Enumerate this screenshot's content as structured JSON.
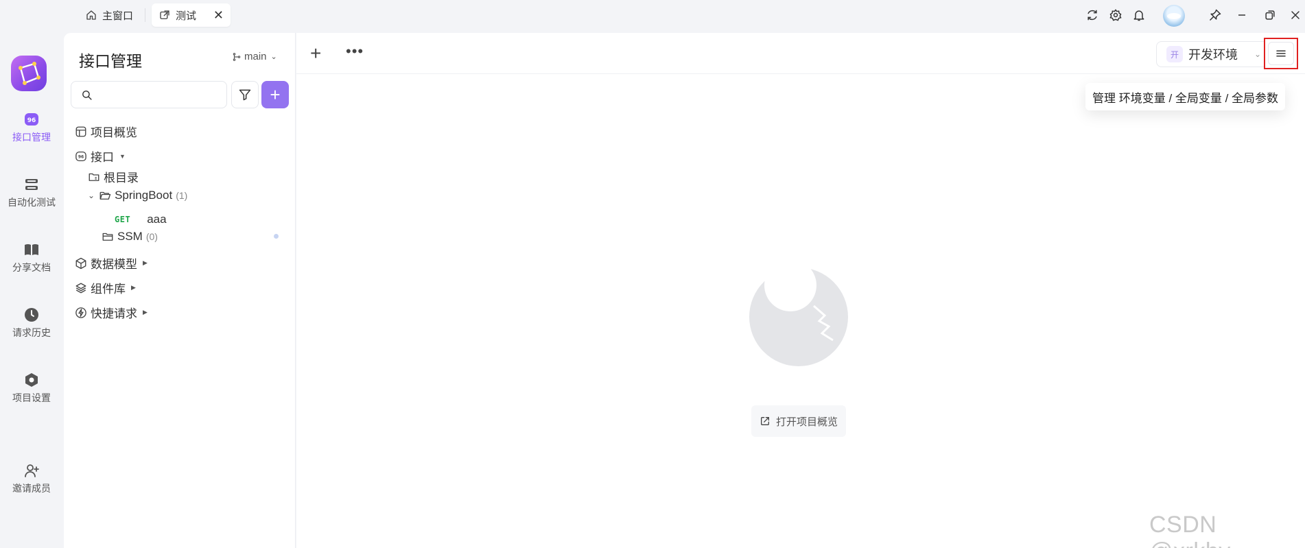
{
  "titlebar": {
    "tabs": [
      {
        "label": "主窗口"
      },
      {
        "label": "测试"
      }
    ],
    "close_glyph": "✕",
    "icons": [
      "refresh-icon",
      "gear-icon",
      "bell-icon",
      "avatar",
      "pin-icon",
      "minimize-icon",
      "restore-icon",
      "close-icon"
    ]
  },
  "leftnav": {
    "items": [
      {
        "label": "接口管理",
        "icon": "api-icon",
        "active": true
      },
      {
        "label": "自动化测试",
        "icon": "automation-icon"
      },
      {
        "label": "分享文档",
        "icon": "book-icon"
      },
      {
        "label": "请求历史",
        "icon": "clock-icon"
      },
      {
        "label": "项目设置",
        "icon": "settings-hex-icon"
      },
      {
        "label": "邀请成员",
        "icon": "invite-user-icon"
      }
    ]
  },
  "sidebar": {
    "title": "接口管理",
    "branch": "main",
    "search_placeholder": "",
    "add_glyph": "+",
    "tree": {
      "overview": "项目概览",
      "interfaces": "接口",
      "root": "根目录",
      "springboot": {
        "name": "SpringBoot",
        "count": "(1)"
      },
      "api_method": "GET",
      "api_name": "aaa",
      "ssm": {
        "name": "SSM",
        "count": "(0)"
      },
      "data_model": "数据模型",
      "components": "组件库",
      "quick_request": "快捷请求"
    }
  },
  "main": {
    "plus_glyph": "+",
    "more_glyph": "•••",
    "env": {
      "badge": "开",
      "name": "开发环境"
    },
    "tooltip": "管理 环境变量 / 全局变量 / 全局参数",
    "open_overview": "打开项目概览"
  },
  "watermark": "CSDN @xrkhy",
  "colors": {
    "accent": "#9373f0",
    "active_nav": "#8b5cf6",
    "get_method": "#20a64a",
    "highlight_border": "#e02020"
  }
}
